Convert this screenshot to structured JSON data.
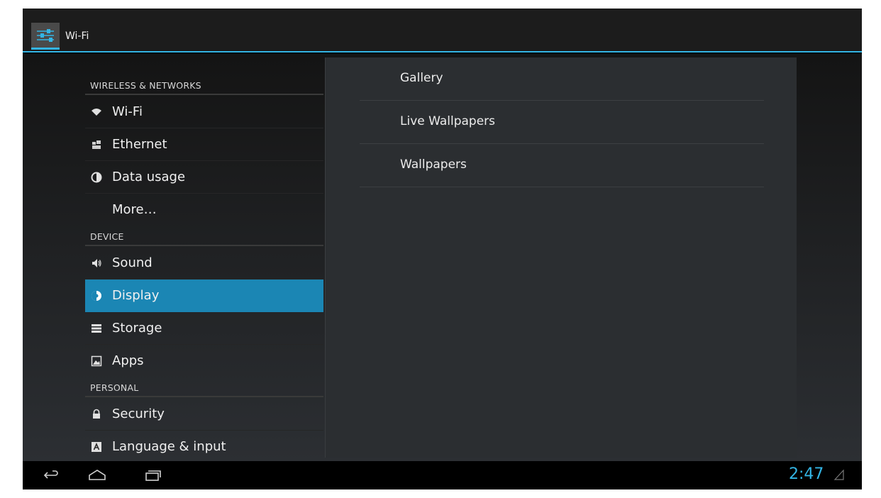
{
  "action_bar": {
    "title": "Wi-Fi",
    "icon": "settings-sliders-icon"
  },
  "left_pane": {
    "sections": [
      {
        "header": "WIRELESS & NETWORKS"
      },
      {
        "header": "DEVICE"
      },
      {
        "header": "PERSONAL"
      }
    ],
    "items": [
      {
        "label": "Wi-Fi",
        "icon": "wifi-icon"
      },
      {
        "label": "Ethernet",
        "icon": "ethernet-icon"
      },
      {
        "label": "Data usage",
        "icon": "data-usage-icon"
      },
      {
        "label": "More…",
        "icon": ""
      },
      {
        "label": "Sound",
        "icon": "sound-icon"
      },
      {
        "label": "Display",
        "icon": "display-icon",
        "selected": true
      },
      {
        "label": "Storage",
        "icon": "storage-icon"
      },
      {
        "label": "Apps",
        "icon": "apps-icon"
      },
      {
        "label": "Security",
        "icon": "lock-icon"
      },
      {
        "label": "Language & input",
        "icon": "language-icon"
      }
    ]
  },
  "right_pane": {
    "items": [
      {
        "label": "Gallery"
      },
      {
        "label": "Live Wallpapers"
      },
      {
        "label": "Wallpapers"
      }
    ]
  },
  "nav_bar": {
    "buttons": [
      "back-icon",
      "home-icon",
      "recent-apps-icon"
    ],
    "clock": "2:47",
    "status_icon": "signal-icon"
  },
  "colors": {
    "accent": "#33b5e5",
    "selected": "#1b86b4",
    "panel": "#2b2e31"
  }
}
